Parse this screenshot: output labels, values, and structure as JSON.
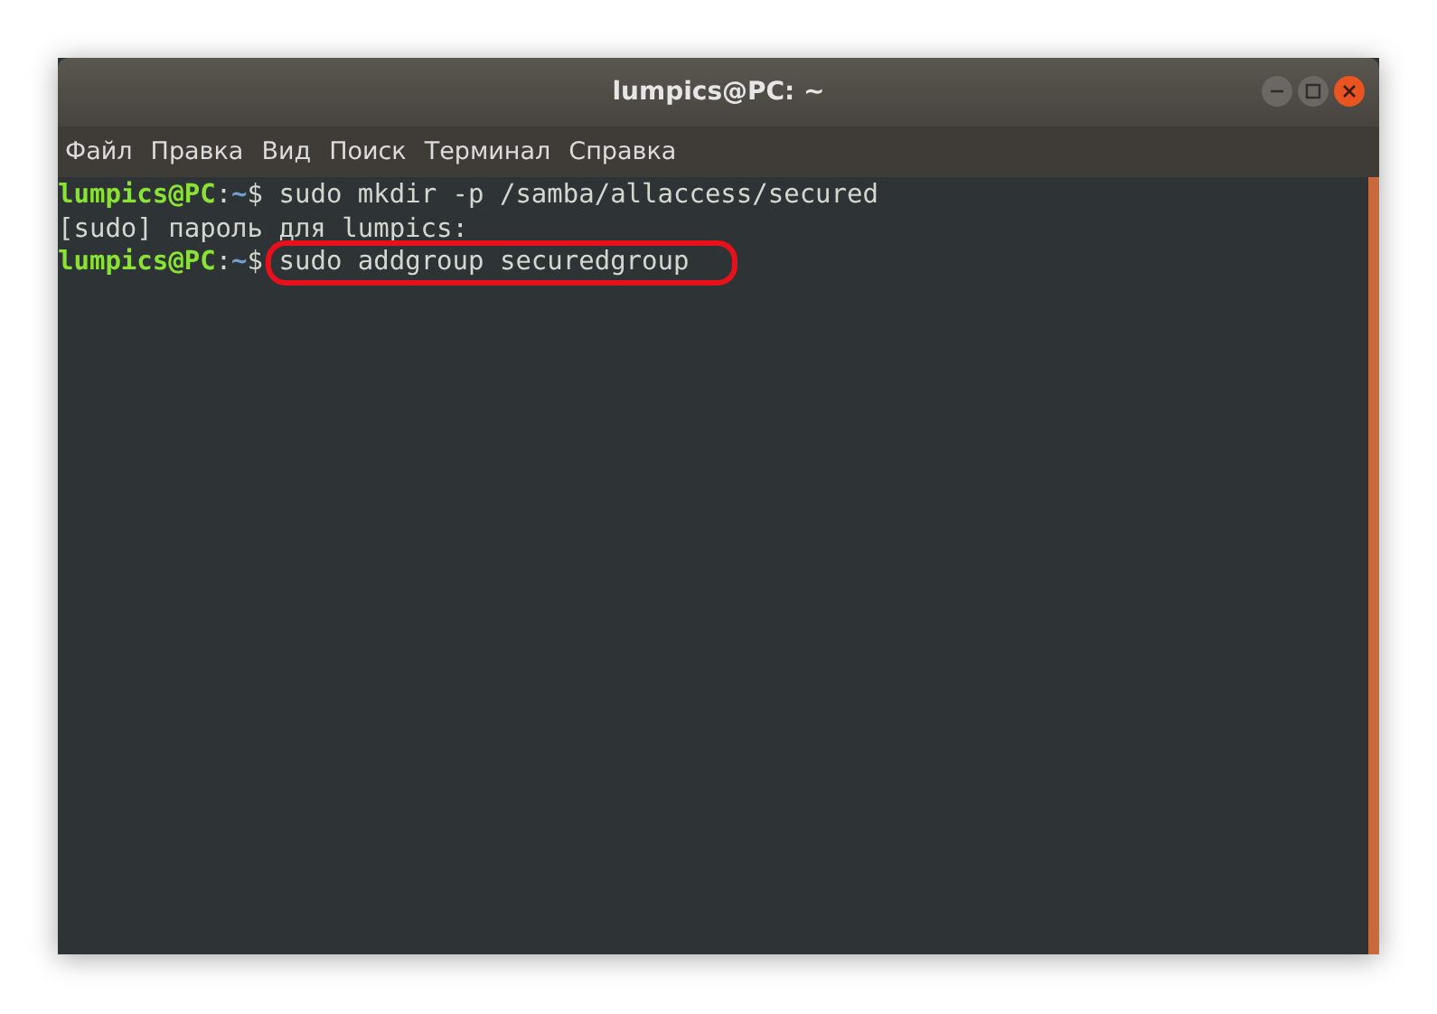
{
  "window": {
    "title": "lumpics@PC: ~"
  },
  "menu": [
    "Файл",
    "Правка",
    "Вид",
    "Поиск",
    "Терминал",
    "Справка"
  ],
  "lines": [
    {
      "kind": "prompt",
      "user": "lumpics@PC",
      "sep": ":",
      "path": "~",
      "sign": "$ ",
      "command": "sudo mkdir -p /samba/allaccess/secured",
      "highlighted": false
    },
    {
      "kind": "output",
      "text": "[sudo] пароль для lumpics:"
    },
    {
      "kind": "prompt",
      "user": "lumpics@PC",
      "sep": ":",
      "path": "~",
      "sign": "$ ",
      "command": "sudo addgroup securedgroup",
      "highlighted": true
    }
  ]
}
